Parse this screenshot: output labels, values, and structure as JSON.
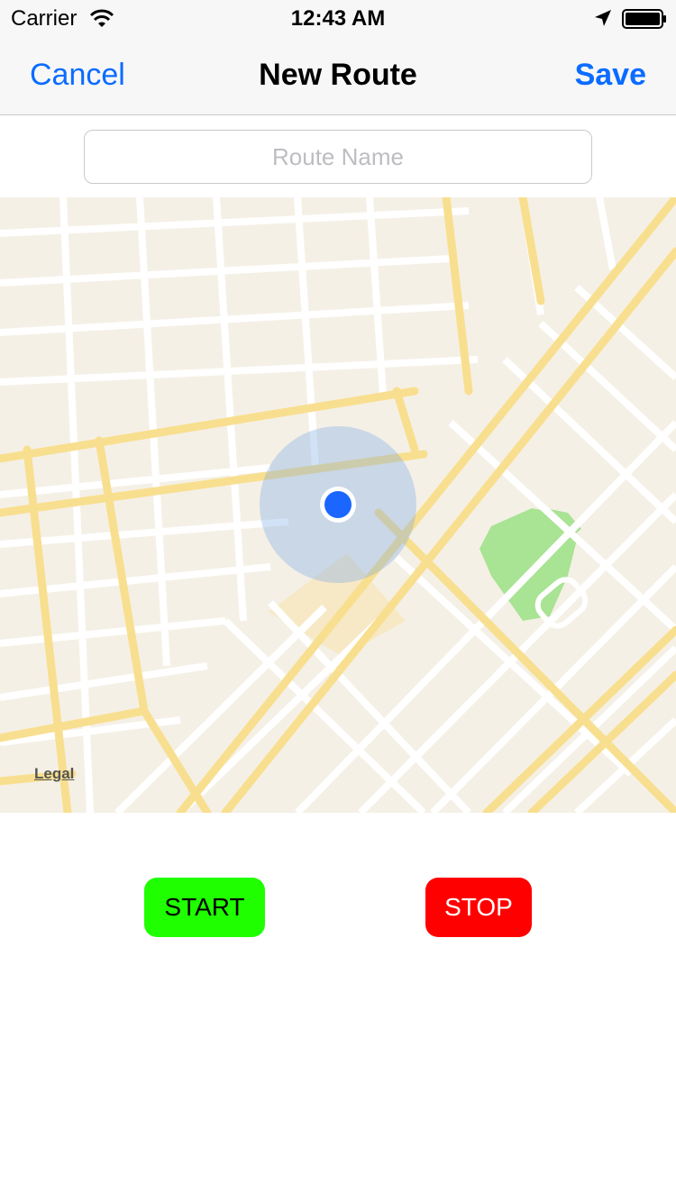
{
  "status_bar": {
    "carrier": "Carrier",
    "time": "12:43 AM",
    "icons": [
      "wifi-icon",
      "location-arrow-icon",
      "battery-icon"
    ]
  },
  "nav": {
    "cancel_label": "Cancel",
    "title": "New Route",
    "save_label": "Save"
  },
  "route_name": {
    "placeholder": "Route Name",
    "value": ""
  },
  "map": {
    "legal_label": "Legal"
  },
  "controls": {
    "start_label": "START",
    "stop_label": "STOP"
  },
  "colors": {
    "accent": "#0b6cff",
    "start_button": "#20ff00",
    "stop_button": "#ff0000",
    "map_background": "#f5f0e6",
    "user_location": "#1a66ff"
  }
}
